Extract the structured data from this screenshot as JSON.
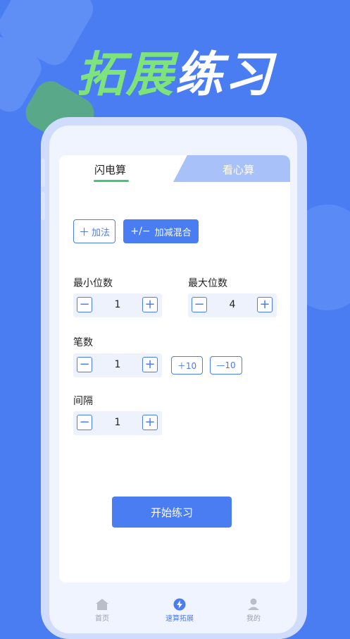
{
  "hero": {
    "title_part1": "拓展",
    "title_part2": "练习"
  },
  "tabs": [
    {
      "label": "闪电算",
      "active": true
    },
    {
      "label": "看心算",
      "active": false
    }
  ],
  "modes": [
    {
      "icon": "＋",
      "label": "加法",
      "selected": false
    },
    {
      "icon": "+/−",
      "label": "加减混合",
      "selected": true
    }
  ],
  "settings": {
    "min_digits": {
      "label": "最小位数",
      "value": "1"
    },
    "max_digits": {
      "label": "最大位数",
      "value": "4"
    },
    "count": {
      "label": "笔数",
      "value": "1",
      "plus10": "＋10",
      "minus10": "—10"
    },
    "interval": {
      "label": "间隔",
      "value": "1"
    }
  },
  "start_button": "开始练习",
  "bottom_nav": [
    {
      "label": "首页",
      "icon": "home-icon",
      "active": false
    },
    {
      "label": "速算拓展",
      "icon": "lightning-icon",
      "active": true
    },
    {
      "label": "我的",
      "icon": "user-icon",
      "active": false
    }
  ],
  "colors": {
    "primary": "#4a7df2",
    "accent_green": "#7ee37a",
    "tab_underline": "#44c67a"
  }
}
